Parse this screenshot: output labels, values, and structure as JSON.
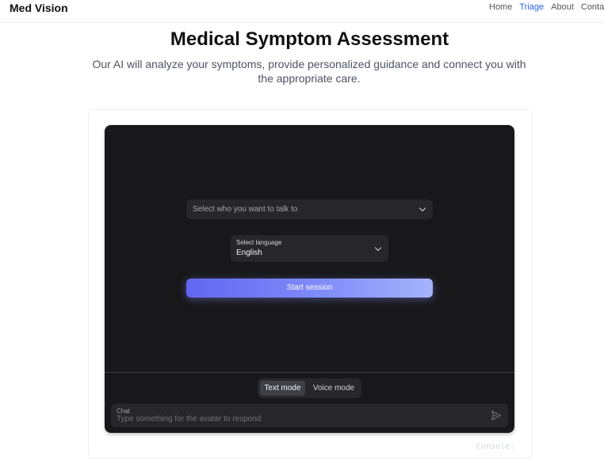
{
  "header": {
    "brand": "Med Vision",
    "nav": [
      {
        "label": "Home",
        "active": false
      },
      {
        "label": "Triage",
        "active": true
      },
      {
        "label": "About",
        "active": false
      },
      {
        "label": "Conta",
        "active": false
      }
    ]
  },
  "hero": {
    "title": "Medical Symptom Assessment",
    "subtitle": "Our AI will analyze your symptoms, provide personalized guidance and connect you with the appropriate care."
  },
  "session": {
    "avatar_select_placeholder": "Select who you want to talk to",
    "language_label": "Select language",
    "language_value": "English",
    "start_button": "Start session",
    "modes": [
      "Text mode",
      "Voice mode"
    ],
    "selected_mode": "Text mode",
    "chat_label": "Chat",
    "chat_placeholder": "Type something for the avatar to respond"
  },
  "console": {
    "label": "Console:"
  },
  "colors": {
    "accent": "#2563eb",
    "panel_bg": "#18181b",
    "button_gradient_start": "#6366f1",
    "button_gradient_end": "#a5b4fc"
  }
}
